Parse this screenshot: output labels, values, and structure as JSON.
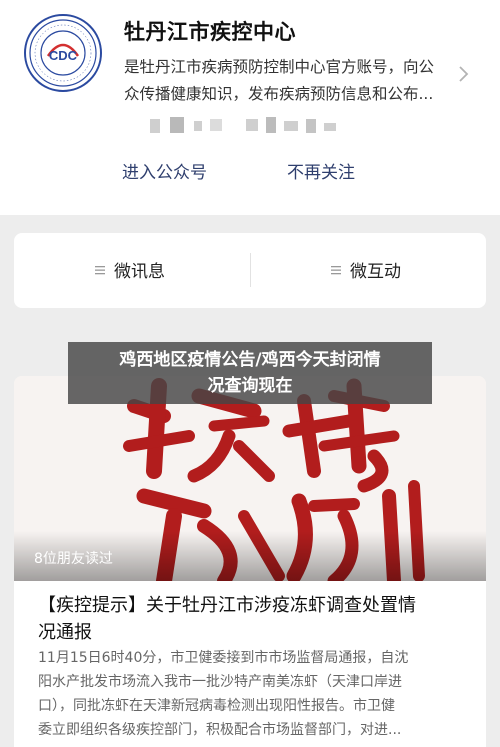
{
  "account": {
    "name": "牡丹江市疾控中心",
    "description_lines": [
      "是牡丹江市疾病预防控制中心官方账号，向公",
      "众传播健康知识，发布疾病预防信息和公布..."
    ],
    "logo_text": "CDC",
    "follow_label": "进入公众号",
    "unfollow_label": "不再关注"
  },
  "menu": {
    "items": [
      {
        "label": "微讯息"
      },
      {
        "label": "微互动"
      }
    ]
  },
  "headline": {
    "lines": [
      "鸡西地区疫情公告/鸡西今天封闭情",
      "况查询现在"
    ]
  },
  "article": {
    "read_count": "8位朋友读过",
    "title_lines": [
      "【疾控提示】关于牡丹江市涉疫冻虾调查处置情",
      "况通报"
    ],
    "excerpt_lines": [
      "11月15日6时40分，市卫健委接到市市场监督局通报，自沈",
      "阳水产批发市场流入我市一批沙特产南美冻虾（天津口岸进",
      "口），同批冻虾在天津新冠病毒检测出现阳性报告。市卫健",
      "委立即组织各级疾控部门，积极配合市场监督部门，对进..."
    ],
    "cover_calligraphy": "提特别"
  },
  "colors": {
    "page_bg": "#ededed",
    "link_text": "#2f3f6e",
    "overlay_bg": "#464646",
    "cover_ink": "#b21d1d"
  }
}
